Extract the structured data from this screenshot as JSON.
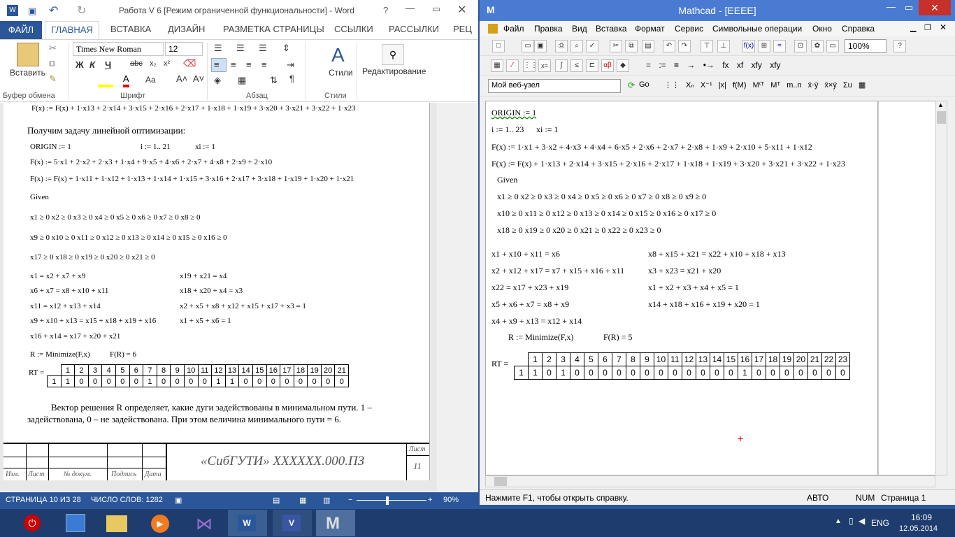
{
  "word": {
    "title": "Работа V 6 [Режим ограниченной функциональности] - Word",
    "tabs": [
      "ФАЙЛ",
      "ГЛАВНАЯ",
      "ВСТАВКА",
      "ДИЗАЙН",
      "РАЗМЕТКА СТРАНИЦЫ",
      "ССЫЛКИ",
      "РАССЫЛКИ",
      "РЕЦ"
    ],
    "font_name": "Times New Roman",
    "font_size": "12",
    "paste_label": "Вставить",
    "styles_label": "Стили",
    "editing_label": "Редактирование",
    "groups": [
      "Буфер обмена",
      "Шрифт",
      "Абзац",
      "Стили"
    ],
    "page": {
      "line_top": "F(x) := F(x) + 1·x13 + 2·x14 + 3·x15 + 2·x16 + 2·x17 + 1·x18 + 1·x19 + 3·x20 + 3·x21 + 3·x22 + 1·x23",
      "heading": "Получим задачу линейной оптимизации:",
      "origin": "ORIGIN := 1",
      "range": "i := 1.. 21",
      "init": "xi := 1",
      "f1": "F(x) := 5·x1 + 2·x2 + 2·x3 + 1·x4 + 9·x5 + 4·x6 + 2·x7 + 4·x8 + 2·x9 + 2·x10",
      "f2": "F(x) := F(x) + 1·x11 + 1·x12 + 1·x13 + 1·x14 + 1·x15 + 3·x16 + 2·x17 + 3·x18 + 1·x19 + 1·x20 + 1·x21",
      "given": "Given",
      "ineq1": "x1 ≥ 0   x2 ≥ 0   x3 ≥ 0   x4 ≥ 0   x5 ≥ 0   x6 ≥ 0   x7 ≥ 0   x8 ≥ 0",
      "ineq2": "x9 ≥ 0   x10 ≥ 0  x11 ≥ 0  x12 ≥ 0  x13 ≥ 0  x14 ≥ 0  x15 ≥ 0  x16 ≥ 0",
      "ineq3": "x17 ≥ 0  x18 ≥ 0  x19 ≥ 0  x20 ≥ 0  x21 ≥ 0",
      "eq_left": [
        "x1 = x2 + x7 + x9",
        "x6 + x7 = x8 + x10 + x11",
        "x11 = x12 + x13 + x14",
        "x9 + x10 + x13 = x15 + x18 + x19 + x16",
        "x16 + x14 = x17 + x20 + x21"
      ],
      "eq_right": [
        "x19 + x21 = x4",
        "x18 + x20 + x4 = x3",
        "x2 + x5 + x8 + x12 + x15 + x17 + x3 = 1",
        "x1 + x5 + x6 = 1"
      ],
      "minimize": "R := Minimize(F,x)",
      "fr": "F(R) = 6",
      "rt_label": "RT =",
      "vec_head": [
        "1",
        "2",
        "3",
        "4",
        "5",
        "6",
        "7",
        "8",
        "9",
        "10",
        "11",
        "12",
        "13",
        "14",
        "15",
        "16",
        "17",
        "18",
        "19",
        "20",
        "21"
      ],
      "vec_vals": [
        "1",
        "0",
        "0",
        "0",
        "0",
        "0",
        "1",
        "0",
        "0",
        "0",
        "0",
        "1",
        "1",
        "0",
        "0",
        "0",
        "0",
        "0",
        "0",
        "0",
        "0"
      ],
      "para1": "Вектор решения R определяет, какие дуги задействованы в минимальном пути. 1 –",
      "para2": "задействована, 0 – не задействована. При этом величина минимального пути = 6.",
      "stamp_title": "«СибГУТИ» XXXXXX.000.ПЗ",
      "stamp_sheet": "Лист",
      "stamp_num": "11",
      "stamp_cols": [
        "Изм.",
        "Лист",
        "№ докум.",
        "Подпись",
        "Дата"
      ]
    },
    "status": {
      "page": "СТРАНИЦА 10 ИЗ 28",
      "words": "ЧИСЛО СЛОВ: 1282",
      "zoom": "90%"
    }
  },
  "mathcad": {
    "title": "Mathcad - [EEEE]",
    "menu": [
      "Файл",
      "Правка",
      "Вид",
      "Вставка",
      "Формат",
      "Сервис",
      "Символьные операции",
      "Окно",
      "Справка"
    ],
    "zoom": "100%",
    "web": "Мой веб-узел",
    "go": "Go",
    "doc": {
      "origin": "ORIGIN := 1",
      "range": "i := 1.. 23",
      "init": "xi := 1",
      "f1": "F(x) := 1·x1 + 3·x2 + 4·x3 + 4·x4 + 6·x5 + 2·x6 + 2·x7 + 2·x8 + 1·x9 + 2·x10 + 5·x11 + 1·x12",
      "f2": "F(x) := F(x) + 1·x13 + 2·x14 + 3·x15 + 2·x16 + 2·x17 + 1·x18 + 1·x19 + 3·x20 + 3·x21 + 3·x22 + 1·x23",
      "given": "Given",
      "ineq1": "x1 ≥ 0   x2 ≥ 0   x3 ≥ 0   x4 ≥ 0   x5 ≥ 0   x6 ≥ 0   x7 ≥ 0   x8 ≥ 0   x9 ≥ 0",
      "ineq2": "x10 ≥ 0  x11 ≥ 0  x12 ≥ 0  x13 ≥ 0  x14 ≥ 0  x15 ≥ 0  x16 ≥ 0  x17 ≥ 0",
      "ineq3": "x18 ≥ 0  x19 ≥ 0  x20 ≥ 0  x21 ≥ 0  x22 ≥ 0  x23 ≥ 0",
      "eq_left": [
        "x1 + x10 + x11 = x6",
        "x2 + x12 + x17 = x7 + x15 + x16 + x11",
        "x22 = x17 + x23 + x19",
        "x5 + x6 + x7 = x8 + x9",
        "x4 + x9 + x13 = x12 + x14"
      ],
      "eq_right": [
        "x8 + x15 + x21 = x22 + x10 + x18 + x13",
        "x3 + x23 = x21 + x20",
        "x1 + x2 + x3 + x4 + x5 = 1",
        "x14 + x18 + x16 + x19 + x20 = 1"
      ],
      "minimize": "R := Minimize(F,x)",
      "fr": "F(R) = 5",
      "rt_label": "RT =",
      "vec_head": [
        "1",
        "2",
        "3",
        "4",
        "5",
        "6",
        "7",
        "8",
        "9",
        "10",
        "11",
        "12",
        "13",
        "14",
        "15",
        "16",
        "17",
        "18",
        "19",
        "20",
        "21",
        "22",
        "23"
      ],
      "vec_vals": [
        "1",
        "0",
        "1",
        "0",
        "0",
        "0",
        "0",
        "0",
        "0",
        "0",
        "0",
        "0",
        "0",
        "0",
        "0",
        "1",
        "0",
        "0",
        "0",
        "0",
        "0",
        "0",
        "0"
      ]
    },
    "status": {
      "help": "Нажмите F1, чтобы открыть справку.",
      "auto": "АВТО",
      "num": "NUM",
      "page": "Страница 1"
    }
  },
  "taskbar": {
    "lang": "ENG",
    "time": "16:09",
    "date": "12.05.2014"
  }
}
